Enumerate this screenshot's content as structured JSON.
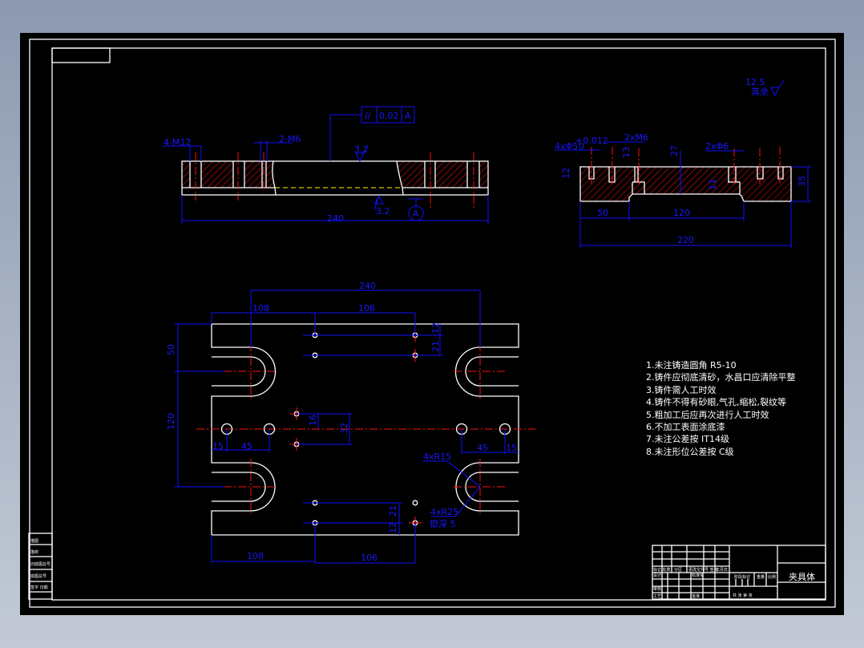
{
  "drawing": {
    "title": "夹具体",
    "colors": {
      "outline": "#ffffff",
      "dimension": "#1010ff",
      "center": "#ff1010",
      "hatch": "#ff1010",
      "hidden": "#ffff00",
      "background": "#000000"
    },
    "front_view": {
      "tolerance_symbol": "//",
      "tolerance_value": "0.02",
      "datum": "A",
      "thread_left": "4-M12",
      "thread_mid": "2-M6",
      "roughness_top": "3.2",
      "roughness_bottom": "3.2",
      "datum_label": "A",
      "overall": "240"
    },
    "side_view": {
      "roughness_other_label": "其余",
      "roughness_other": "12.5",
      "holes_label": "4xΦ5",
      "holes_tol_upper": "+0.012",
      "holes_tol_lower": "0",
      "thread_label": "2xM6",
      "pin_label": "2xΦ6",
      "dims": {
        "d12": "12",
        "d13": "13",
        "d27": "27",
        "d11": "11",
        "d35": "35",
        "d50": "50",
        "d120": "120",
        "d220": "220"
      }
    },
    "plan_view": {
      "dims": {
        "top240": "240",
        "top108": "108",
        "top106": "106",
        "r12": "12",
        "r21": "21",
        "left50": "50",
        "left120": "120",
        "c16": "16",
        "c32": "32",
        "l15": "15",
        "l45": "45",
        "r45": "45",
        "r15": "15",
        "b21": "21",
        "b12": "12",
        "b108": "108",
        "b106": "106"
      },
      "r15_label": "4xR15",
      "r25_label": "4xR25",
      "depth_label": "锪深 5"
    },
    "notes": [
      "1.未注铸造圆角 R5-10",
      "2.铸件应彻底清砂，水昌口应清除平整",
      "3.铸件需人工时效",
      "4.铸件不得有砂眼,气孔,缩松,裂纹等",
      "5.粗加工后应再次进行人工时效",
      "6.不加工表面涂底漆",
      "7.未注公差按 IT14级",
      "8.未注形位公差按 C级"
    ],
    "title_block": {
      "row1": "标记 处数",
      "row1b": "分区",
      "row1c": "更改文件号 签名",
      "row1d": "年月日",
      "design": "设计",
      "check": "审核",
      "process": "工艺",
      "std": "标准化",
      "approve": "批准",
      "stage": "阶段标记",
      "weight": "重量",
      "scale": "比例",
      "sheets": "共  张 第  张"
    },
    "side_table": [
      "描图",
      "描校",
      "旧底图总号",
      "底图总号",
      "签字 日期"
    ]
  }
}
